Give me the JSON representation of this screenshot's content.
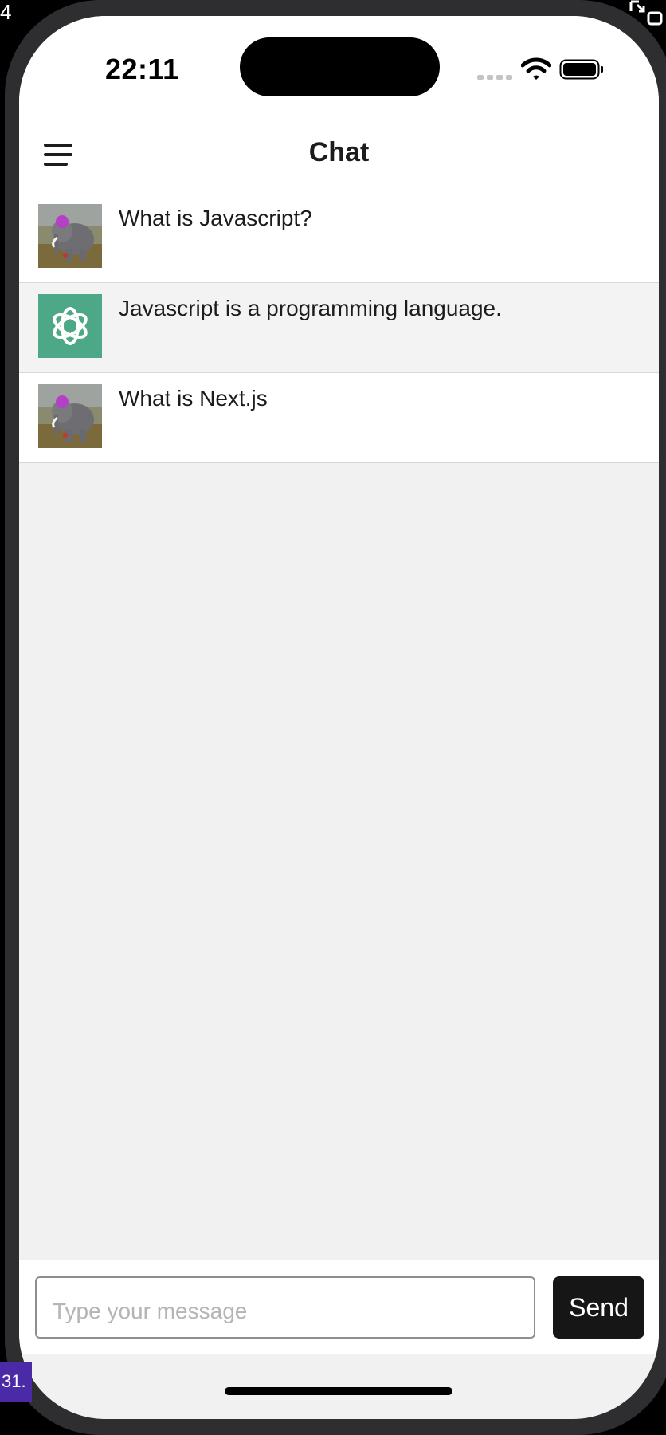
{
  "system": {
    "corner_left_text": "4",
    "corner_bottom_text": "31."
  },
  "status_bar": {
    "time": "22:11",
    "icons": [
      "cellular-signal-icon",
      "wifi-icon",
      "battery-icon"
    ]
  },
  "header": {
    "title": "Chat",
    "menu_icon": "hamburger-menu-icon"
  },
  "messages": [
    {
      "role": "user",
      "avatar": "elephant-avatar",
      "text": "What is Javascript?"
    },
    {
      "role": "assistant",
      "avatar": "openai-logo",
      "text": "Javascript is a programming language."
    },
    {
      "role": "user",
      "avatar": "elephant-avatar",
      "text": "What is Next.js"
    }
  ],
  "composer": {
    "placeholder": "Type your message",
    "value": "",
    "send_label": "Send"
  },
  "colors": {
    "bot_avatar_bg": "#4ca887",
    "send_bg": "#161616",
    "chat_bg": "#f1f1f1"
  }
}
